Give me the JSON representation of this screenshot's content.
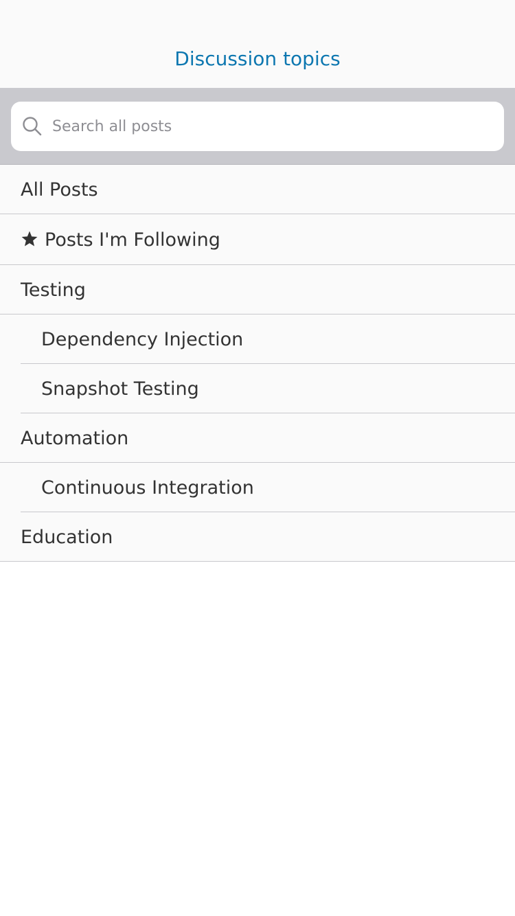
{
  "nav": {
    "title": "Discussion topics"
  },
  "search": {
    "placeholder": "Search all posts",
    "icon": "search-icon"
  },
  "topics": [
    {
      "label": "All Posts",
      "level": 0
    },
    {
      "label": "Posts I'm Following",
      "level": 0,
      "icon": "star-icon"
    },
    {
      "label": "Testing",
      "level": 0
    },
    {
      "label": "Dependency Injection",
      "level": 1
    },
    {
      "label": "Snapshot Testing",
      "level": 1
    },
    {
      "label": "Automation",
      "level": 0
    },
    {
      "label": "Continuous Integration",
      "level": 1
    },
    {
      "label": "Education",
      "level": 0
    }
  ],
  "colors": {
    "accent": "#0d77b0",
    "search_bar_bg": "#c9c9ce",
    "list_bg": "#fafafa",
    "separator": "#c8c8cc",
    "text": "#333333"
  }
}
